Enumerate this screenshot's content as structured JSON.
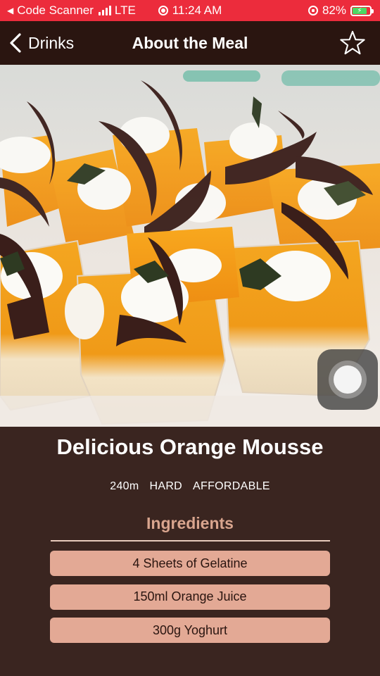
{
  "status_bar": {
    "back_app": "Code Scanner",
    "network": "LTE",
    "time": "11:24 AM",
    "battery": "82%",
    "battery_level": 0.82,
    "bar_color": "#ec2c3c"
  },
  "nav": {
    "back_label": "Drinks",
    "title": "About the Meal",
    "icons": {
      "back": "chevron-left-icon",
      "favorite": "star-outline-icon"
    }
  },
  "meal": {
    "title": "Delicious Orange Mousse",
    "duration": "240m",
    "complexity": "HARD",
    "affordability": "AFFORDABLE",
    "image": "orange mousse dessert cups"
  },
  "ingredients": {
    "title": "Ingredients",
    "items": [
      "4 Sheets of Gelatine",
      "150ml Orange Juice",
      "300g Yoghurt"
    ]
  },
  "colors": {
    "background": "#3a2520",
    "nav_background": "#2a1510",
    "accent": "#d9a58e",
    "pill": "#e3a995"
  }
}
